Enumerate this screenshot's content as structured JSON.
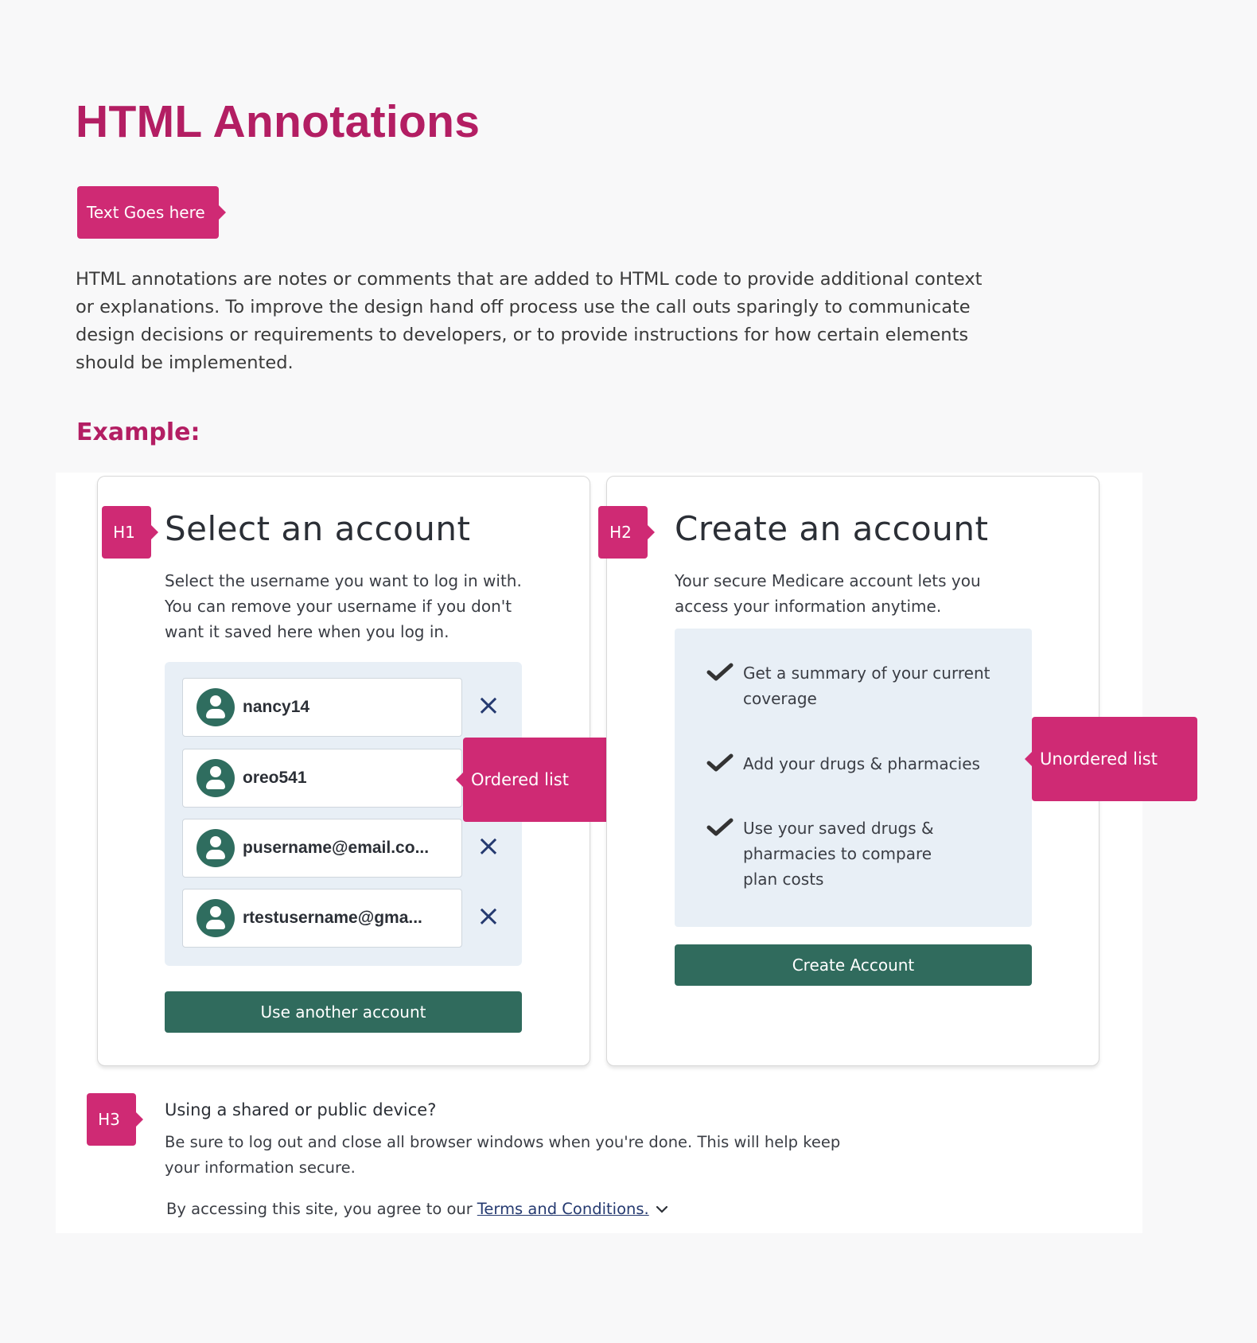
{
  "page": {
    "title": "HTML Annotations",
    "legend_tag": "Text Goes here",
    "intro": "HTML annotations are notes or comments that are added to HTML code to provide additional context or explanations. To improve the design hand off process use the call outs sparingly to communicate design decisions or requirements to developers, or to provide instructions for how certain elements should be implemented.",
    "example_label": "Example:"
  },
  "colors": {
    "heading_pink": "#b31e63",
    "tag_pink": "#cf2a74",
    "button_green": "#306b5d",
    "panel_blue": "#e8eff6",
    "link_navy": "#253a70"
  },
  "annotations": {
    "h1": "H1",
    "h2": "H2",
    "h3": "H3",
    "ordered_list": "Ordered list",
    "unordered_list": "Unordered list"
  },
  "select_card": {
    "title": "Select an account",
    "description": "Select the username you want to log in with. You can remove your username if you don't want it saved here when you log in.",
    "accounts": [
      {
        "username": "nancy14",
        "removable": true
      },
      {
        "username": "oreo541",
        "removable": true
      },
      {
        "username": "pusername@email.co...",
        "removable": true
      },
      {
        "username": "rtestusername@gma...",
        "removable": true
      }
    ],
    "remove_icon": "×",
    "use_another_label": "Use another account"
  },
  "create_card": {
    "title": "Create an account",
    "description": "Your secure Medicare account lets you access your information anytime.",
    "benefits": [
      "Get a summary of your current coverage",
      "Add your drugs & pharmacies",
      "Use your saved drugs & pharmacies to compare plan costs"
    ],
    "create_label": "Create Account"
  },
  "footer": {
    "shared_heading": "Using a shared or public device?",
    "shared_body": "Be sure to log out and close all browser windows when you're done. This will help keep your information secure.",
    "terms_prefix": "By accessing this site, you agree to our",
    "terms_link": "Terms and Conditions."
  }
}
